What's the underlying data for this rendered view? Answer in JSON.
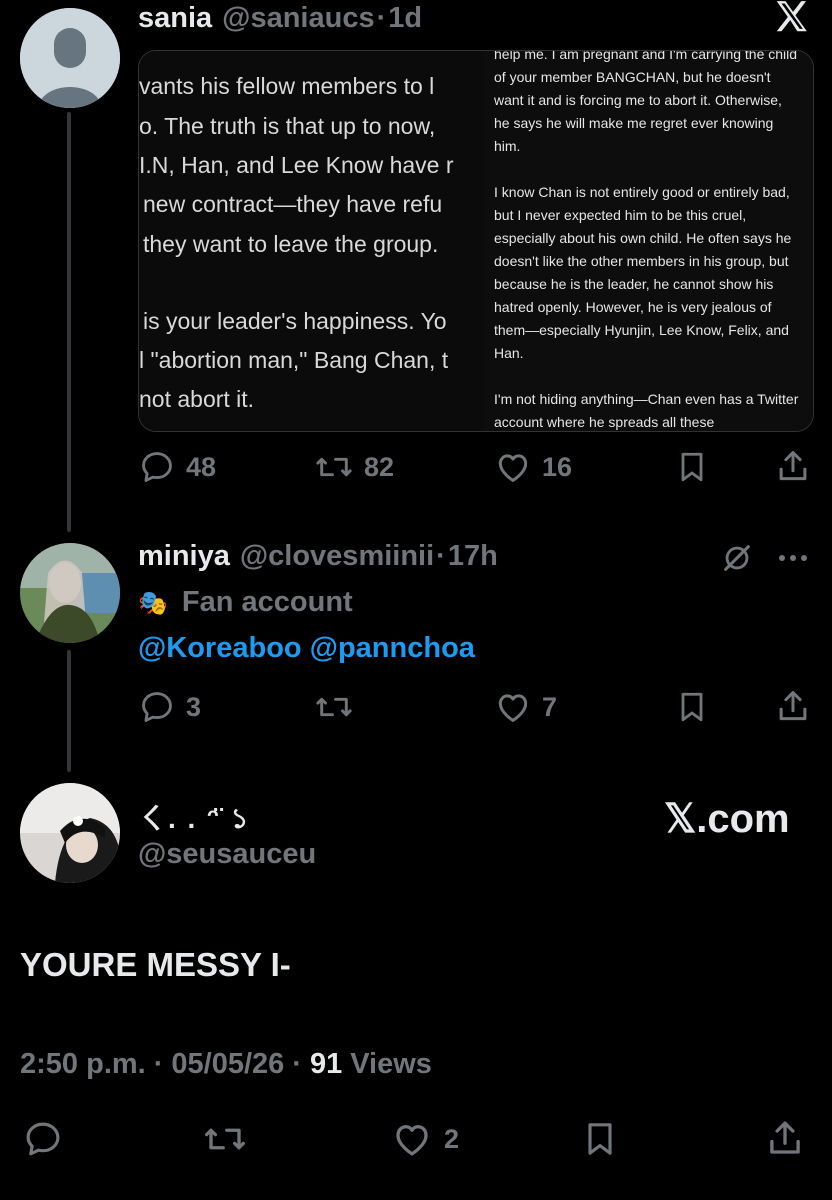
{
  "post1": {
    "name": "sania",
    "handle": "@saniaucs",
    "dot": "·",
    "time": "1d",
    "image_left_lines": [
      "vants his fellow members to l",
      "o. The truth is that up to now,",
      "I.N, Han, and Lee Know have r",
      "new contract—they have refu",
      "they want to leave the group.",
      "",
      "is your leader's happiness. Yo",
      "l \"abortion man,\" Bang Chan, t",
      "not abort it."
    ],
    "image_right_paragraphs": [
      "help me. I am pregnant and I'm carrying the child of your member BANGCHAN, but he doesn't want it and is forcing me to abort it. Otherwise, he says he will make me regret ever knowing him.",
      "I know Chan is not entirely good or entirely bad, but I never expected him to be this cruel, especially about his own child. He often says he doesn't like the other members in his group, but because he is the leader, he cannot show his hatred openly. However, he is very jealous of them—especially Hyunjin, Lee Know, Felix, and Han.",
      "I'm not hiding anything—Chan even has a Twitter account where he spreads all these"
    ],
    "replies": "48",
    "reposts": "82",
    "likes": "16"
  },
  "post2": {
    "name": "miniya",
    "handle": "@clovesmiinii",
    "dot": "·",
    "time": "17h",
    "badge_icon": "🎭",
    "badge_text": "Fan account",
    "mentions": "@Koreaboo @pannchoa",
    "replies": "3",
    "reposts": "",
    "likes": "7"
  },
  "post3": {
    "name": "ㄑ. . ᵔ̈ ১",
    "handle": "@seusauceu",
    "body": "YOURE MESSY I-",
    "time": "2:50 p.m.",
    "date": "05/05/26",
    "views_count": "91",
    "views_label": "Views",
    "dot": "·",
    "likes": "2"
  },
  "brand": {
    "x_logo": "𝕏",
    "x_com": "𝕏.com"
  },
  "colors": {
    "background": "#000000",
    "text": "#e7e9ea",
    "muted": "#71767b",
    "link": "#1d9bf0"
  }
}
